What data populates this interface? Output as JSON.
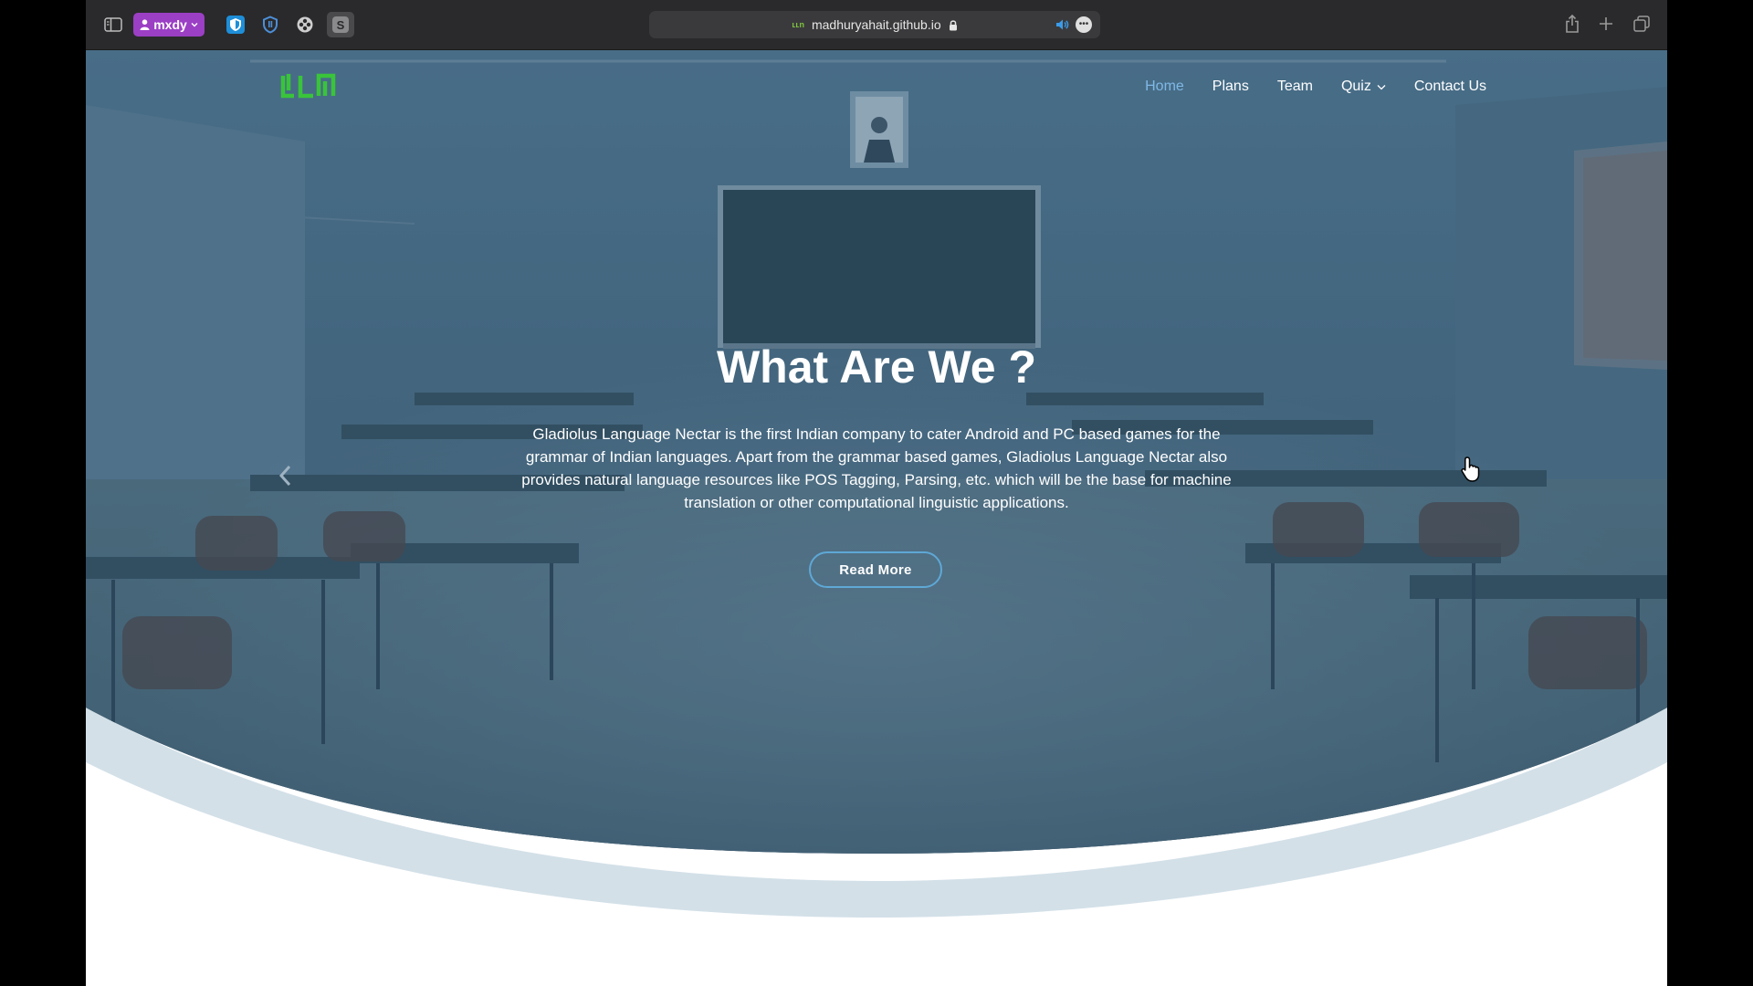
{
  "browser": {
    "profile_name": "mxdy",
    "url": "madhuryahait.github.io",
    "site_icon_text": "ʟʟn",
    "extension_s_label": "S",
    "icons": [
      "sidebar-icon",
      "person-icon",
      "chevron-down-icon",
      "shield-extension-icon",
      "password-manager-icon",
      "puzzle-extension-icon",
      "lock-icon",
      "speaker-icon",
      "more-icon",
      "share-icon",
      "plus-icon",
      "tabs-overview-icon"
    ]
  },
  "nav": {
    "logo_text": "LLN",
    "items": [
      {
        "label": "Home",
        "active": true
      },
      {
        "label": "Plans"
      },
      {
        "label": "Team"
      },
      {
        "label": "Quiz"
      },
      {
        "label": "Contact Us"
      }
    ]
  },
  "hero": {
    "title": "What Are We ?",
    "text": "Gladiolus Language Nectar is the first Indian company to cater Android and PC based games for the grammar of Indian languages. Apart from the grammar based games, Gladiolus Language Nectar also provides natural language resources like POS Tagging, Parsing, etc. which will be the base for machine translation or other computational linguistic applications.",
    "button_label": "Read More"
  },
  "colors": {
    "toolbar": "#2a2a2c",
    "profile": "#9b3fc5",
    "logo": "#39c43a",
    "nav_active": "#7fb8e6",
    "hero_overlay": "#3d5e78",
    "wave": "#d3e0e8",
    "button_border": "#5ea8d6"
  }
}
